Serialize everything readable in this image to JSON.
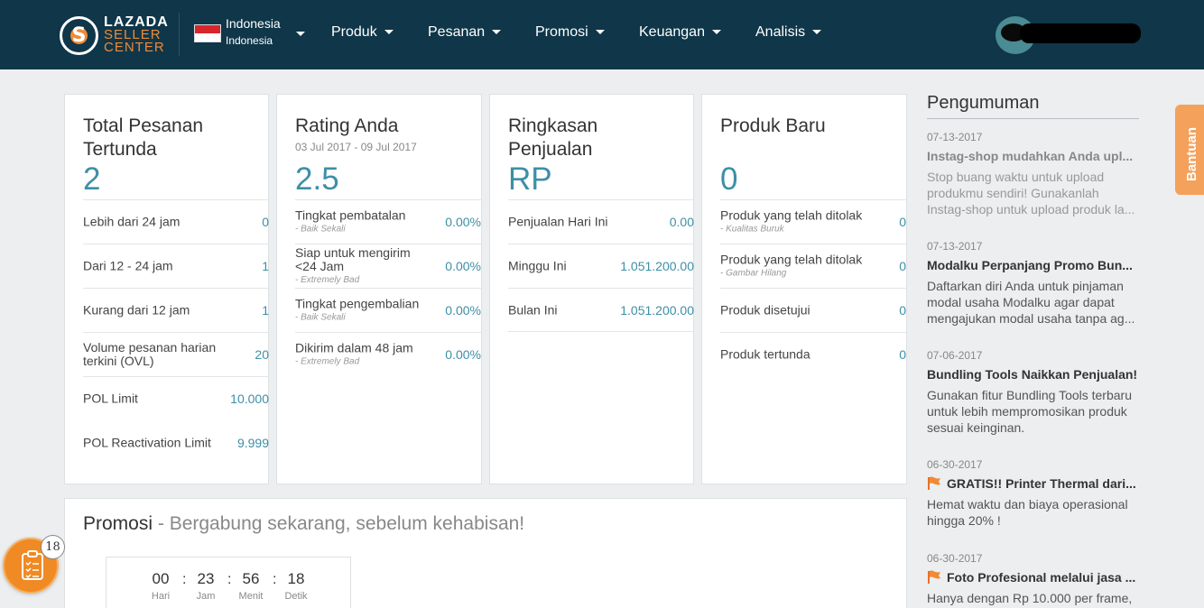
{
  "header": {
    "logo": {
      "line1": "LAZADA",
      "line2": "SELLER",
      "line3": "CENTER"
    },
    "country": {
      "name": "Indonesia",
      "language": "Indonesia"
    },
    "nav": [
      {
        "label": "Produk"
      },
      {
        "label": "Pesanan"
      },
      {
        "label": "Promosi"
      },
      {
        "label": "Keuangan"
      },
      {
        "label": "Analisis"
      }
    ]
  },
  "cards": {
    "pending": {
      "title": "Total Pesanan Tertunda",
      "value": "2",
      "rows": [
        {
          "label": "Lebih dari 24 jam",
          "value": "0"
        },
        {
          "label": "Dari 12 - 24 jam",
          "value": "1"
        },
        {
          "label": "Kurang dari 12 jam",
          "value": "1"
        },
        {
          "label": "Volume pesanan harian terkini (OVL)",
          "value": "20"
        },
        {
          "label": "POL Limit",
          "value": "10.000"
        },
        {
          "label": "POL Reactivation Limit",
          "value": "9.999"
        }
      ]
    },
    "rating": {
      "title": "Rating Anda",
      "date_range": "03 Jul 2017 - 09 Jul 2017",
      "value": "2.5",
      "rows": [
        {
          "label": "Tingkat pembatalan",
          "note": "- Baik Sekali",
          "value": "0.00%"
        },
        {
          "label": "Siap untuk mengirim <24 Jam",
          "note": "- Extremely Bad",
          "value": "0.00%"
        },
        {
          "label": "Tingkat pengembalian",
          "note": "- Baik Sekali",
          "value": "0.00%"
        },
        {
          "label": "Dikirim dalam 48 jam",
          "note": "- Extremely Bad",
          "value": "0.00%"
        }
      ]
    },
    "sales": {
      "title": "Ringkasan Penjualan",
      "value": "RP",
      "rows": [
        {
          "label": "Penjualan Hari Ini",
          "value": "0.00"
        },
        {
          "label": "Minggu Ini",
          "value": "1.051.200.00"
        },
        {
          "label": "Bulan Ini",
          "value": "1.051.200.00"
        }
      ]
    },
    "products": {
      "title": "Produk Baru",
      "value": "0",
      "rows": [
        {
          "label": "Produk yang telah ditolak",
          "note": "- Kualitas Buruk",
          "value": "0"
        },
        {
          "label": "Produk yang telah ditolak",
          "note": "- Gambar Hilang",
          "value": "0"
        },
        {
          "label": "Produk disetujui",
          "value": "0"
        },
        {
          "label": "Produk tertunda",
          "value": "0"
        }
      ]
    }
  },
  "promo": {
    "title": "Promosi",
    "subtitle": "- Bergabung sekarang, sebelum kehabisan!",
    "countdown": [
      {
        "num": "00",
        "label": "Hari"
      },
      {
        "num": "23",
        "label": "Jam"
      },
      {
        "num": "56",
        "label": "Menit"
      },
      {
        "num": "18",
        "label": "Detik"
      }
    ],
    "separator": ":"
  },
  "announcements": {
    "title": "Pengumuman",
    "items": [
      {
        "date": "07-13-2017",
        "headline": "Instag-shop mudahkan Anda upl...",
        "body": "Stop buang waktu untuk upload produkmu sendiri! Gunakanlah Instag-shop untuk upload produk la...",
        "read": true
      },
      {
        "date": "07-13-2017",
        "headline": "Modalku Perpanjang Promo Bun...",
        "body": "Daftarkan diri Anda untuk pinjaman modal usaha Modalku agar dapat mengajukan modal usaha tanpa ag...",
        "read": false
      },
      {
        "date": "07-06-2017",
        "headline": "Bundling Tools Naikkan Penjualan!",
        "body": "Gunakan fitur Bundling Tools terbaru untuk lebih mempromosikan produk sesuai keinginan.",
        "read": false
      },
      {
        "date": "06-30-2017",
        "headline": "GRATIS!! Printer Thermal dari...",
        "body": "Hemat waktu dan biaya operasional hingga 20% !",
        "read": false,
        "flag": "flag-icon"
      },
      {
        "date": "06-30-2017",
        "headline": "Foto Profesional melalui jasa ...",
        "body": "Hanya dengan Rp 10.000 per frame,",
        "read": false,
        "flag": "flag-icon"
      }
    ]
  },
  "help_tab": {
    "label": "Bantuan"
  },
  "task_widget": {
    "badge": "18"
  },
  "colors": {
    "topbar": "#0f3649",
    "accent": "#3d8fa6",
    "orange": "#f08a36"
  }
}
